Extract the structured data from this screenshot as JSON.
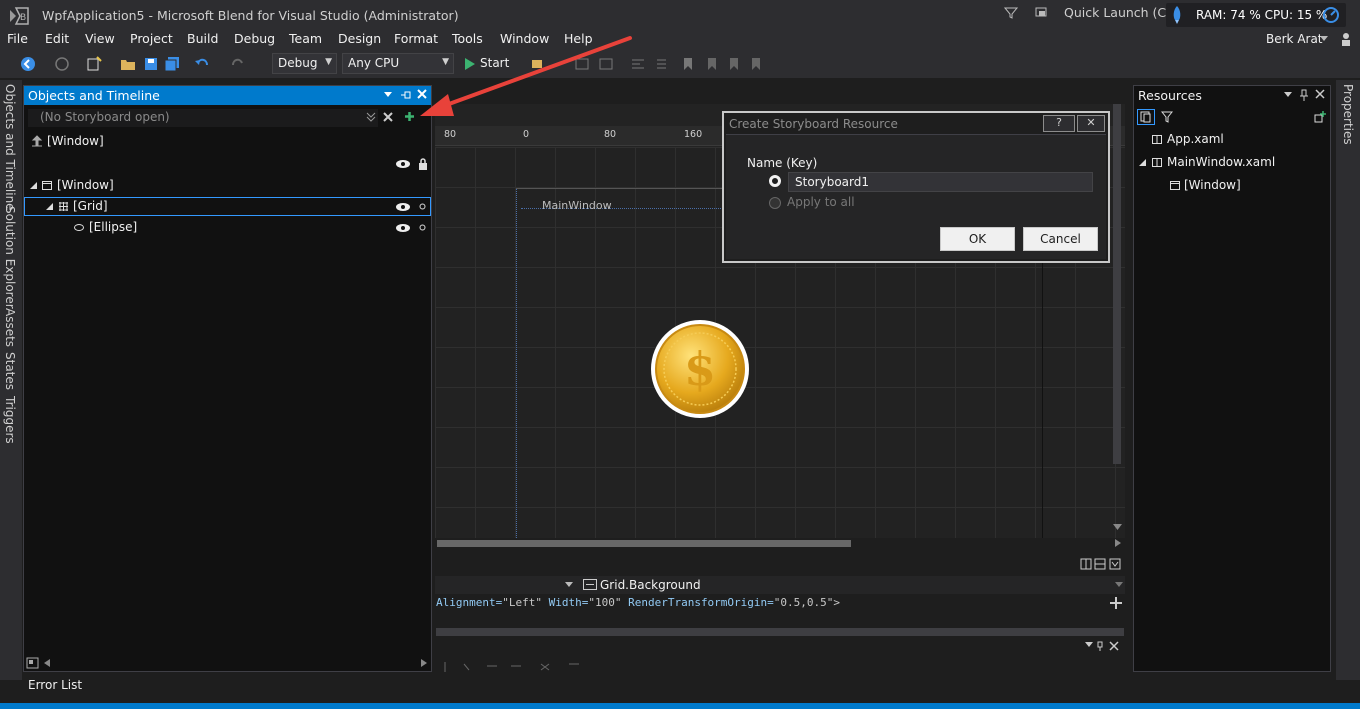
{
  "titlebar": {
    "title": "WpfApplication5 - Microsoft Blend for Visual Studio (Administrator)",
    "quick_launch": "Quick Launch (Ctrl+Q)",
    "perf": "RAM: 74 %  CPU: 15 %"
  },
  "menu": [
    "File",
    "Edit",
    "View",
    "Project",
    "Build",
    "Debug",
    "Team",
    "Design",
    "Format",
    "Tools",
    "Window",
    "Help"
  ],
  "user": "Berk Arat",
  "toolbar": {
    "config": "Debug",
    "platform": "Any CPU",
    "start": "Start"
  },
  "left_tabs": [
    "Objects and Timeline",
    "Solution Explorer",
    "Assets",
    "States",
    "Triggers"
  ],
  "objects_panel": {
    "title": "Objects and Timeline",
    "storyboard": "(No Storyboard open)",
    "scope": "[Window]",
    "tree": [
      {
        "label": "[Window]"
      },
      {
        "label": "[Grid]"
      },
      {
        "label": "[Ellipse]"
      }
    ]
  },
  "canvas": {
    "ruler": [
      "80",
      "0",
      "80",
      "160"
    ],
    "window_label": "MainWindow"
  },
  "xaml": {
    "breadcrumb": "Grid.Background",
    "line": [
      {
        "k": "Alignment=",
        "v": "\"Left\""
      },
      {
        "k": " Width=",
        "v": "\"100\""
      },
      {
        "k": " RenderTransformOrigin=",
        "v": "\"0.5,0.5\">"
      }
    ]
  },
  "resources": {
    "title": "Resources",
    "items": [
      "App.xaml",
      "MainWindow.xaml",
      "[Window]"
    ]
  },
  "right_tab": "Properties",
  "status": {
    "error_list": "Error List"
  },
  "dialog": {
    "title": "Create Storyboard Resource",
    "help": "?",
    "close": "✕",
    "name_label": "Name (Key)",
    "name_value": "Storyboard1",
    "apply_all": "Apply to all",
    "ok": "OK",
    "cancel": "Cancel"
  },
  "colors": {
    "accent": "#007acc",
    "arrow": "#e8423a"
  }
}
